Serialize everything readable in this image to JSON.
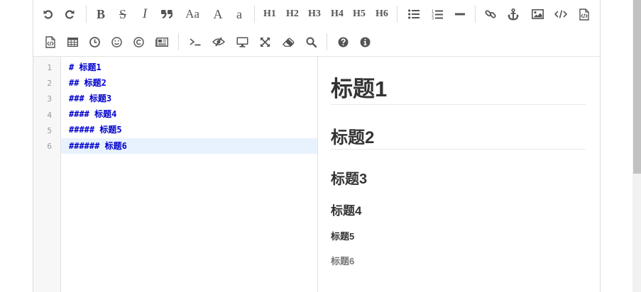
{
  "toolbar": {
    "row1": [
      {
        "name": "undo-button",
        "icon": "undo-icon",
        "title": "Undo"
      },
      {
        "name": "redo-button",
        "icon": "redo-icon",
        "title": "Redo"
      },
      {
        "name": "bold-button",
        "label": "B"
      },
      {
        "name": "strikethrough-button",
        "label": "S"
      },
      {
        "name": "italic-button",
        "label": "I"
      },
      {
        "name": "quote-button",
        "icon": "quote-icon"
      },
      {
        "name": "uppercase-button",
        "label": "Aa"
      },
      {
        "name": "uppercase-all-button",
        "label": "A"
      },
      {
        "name": "lowercase-button",
        "label": "a"
      },
      {
        "name": "h1-button",
        "label": "H1"
      },
      {
        "name": "h2-button",
        "label": "H2"
      },
      {
        "name": "h3-button",
        "label": "H3"
      },
      {
        "name": "h4-button",
        "label": "H4"
      },
      {
        "name": "h5-button",
        "label": "H5"
      },
      {
        "name": "h6-button",
        "label": "H6"
      },
      {
        "name": "unordered-list-button",
        "icon": "list-ul-icon"
      },
      {
        "name": "ordered-list-button",
        "icon": "list-ol-icon"
      },
      {
        "name": "horizontal-rule-button",
        "icon": "minus-icon"
      },
      {
        "name": "link-button",
        "icon": "link-icon"
      },
      {
        "name": "anchor-button",
        "icon": "anchor-icon"
      },
      {
        "name": "image-button",
        "icon": "image-icon"
      },
      {
        "name": "inline-code-button",
        "icon": "code-icon"
      },
      {
        "name": "code-block-button",
        "icon": "file-code-icon"
      }
    ],
    "row2": [
      {
        "name": "preformatted-text-button",
        "icon": "file-code-icon"
      },
      {
        "name": "table-button",
        "icon": "table-icon"
      },
      {
        "name": "datetime-button",
        "icon": "clock-icon"
      },
      {
        "name": "emoji-button",
        "icon": "smile-icon"
      },
      {
        "name": "html-entities-button",
        "icon": "copyright-icon"
      },
      {
        "name": "pagebreak-button",
        "icon": "newspaper-icon"
      },
      {
        "name": "goto-line-button",
        "icon": "terminal-icon"
      },
      {
        "name": "toggle-preview-button",
        "icon": "eye-slash-icon"
      },
      {
        "name": "fullscreen-preview-button",
        "icon": "desktop-icon"
      },
      {
        "name": "fullscreen-button",
        "icon": "expand-icon"
      },
      {
        "name": "clear-button",
        "icon": "eraser-icon"
      },
      {
        "name": "search-button",
        "icon": "search-icon"
      },
      {
        "name": "help-button",
        "icon": "question-circle-icon"
      },
      {
        "name": "info-button",
        "icon": "info-circle-icon"
      }
    ]
  },
  "editor": {
    "line_numbers": [
      "1",
      "2",
      "3",
      "4",
      "5",
      "6"
    ],
    "lines": [
      "# 标题1",
      "## 标题2",
      "### 标题3",
      "#### 标题4",
      "##### 标题5",
      "###### 标题6"
    ],
    "active_line": 6
  },
  "preview": {
    "headings": [
      "标题1",
      "标题2",
      "标题3",
      "标题4",
      "标题5",
      "标题6"
    ]
  },
  "colors": {
    "markdown_text": "#0000cc",
    "active_line_bg": "#e8f2fe",
    "heading_text": "#333333",
    "h6_text": "#777777",
    "icon": "#555555"
  }
}
